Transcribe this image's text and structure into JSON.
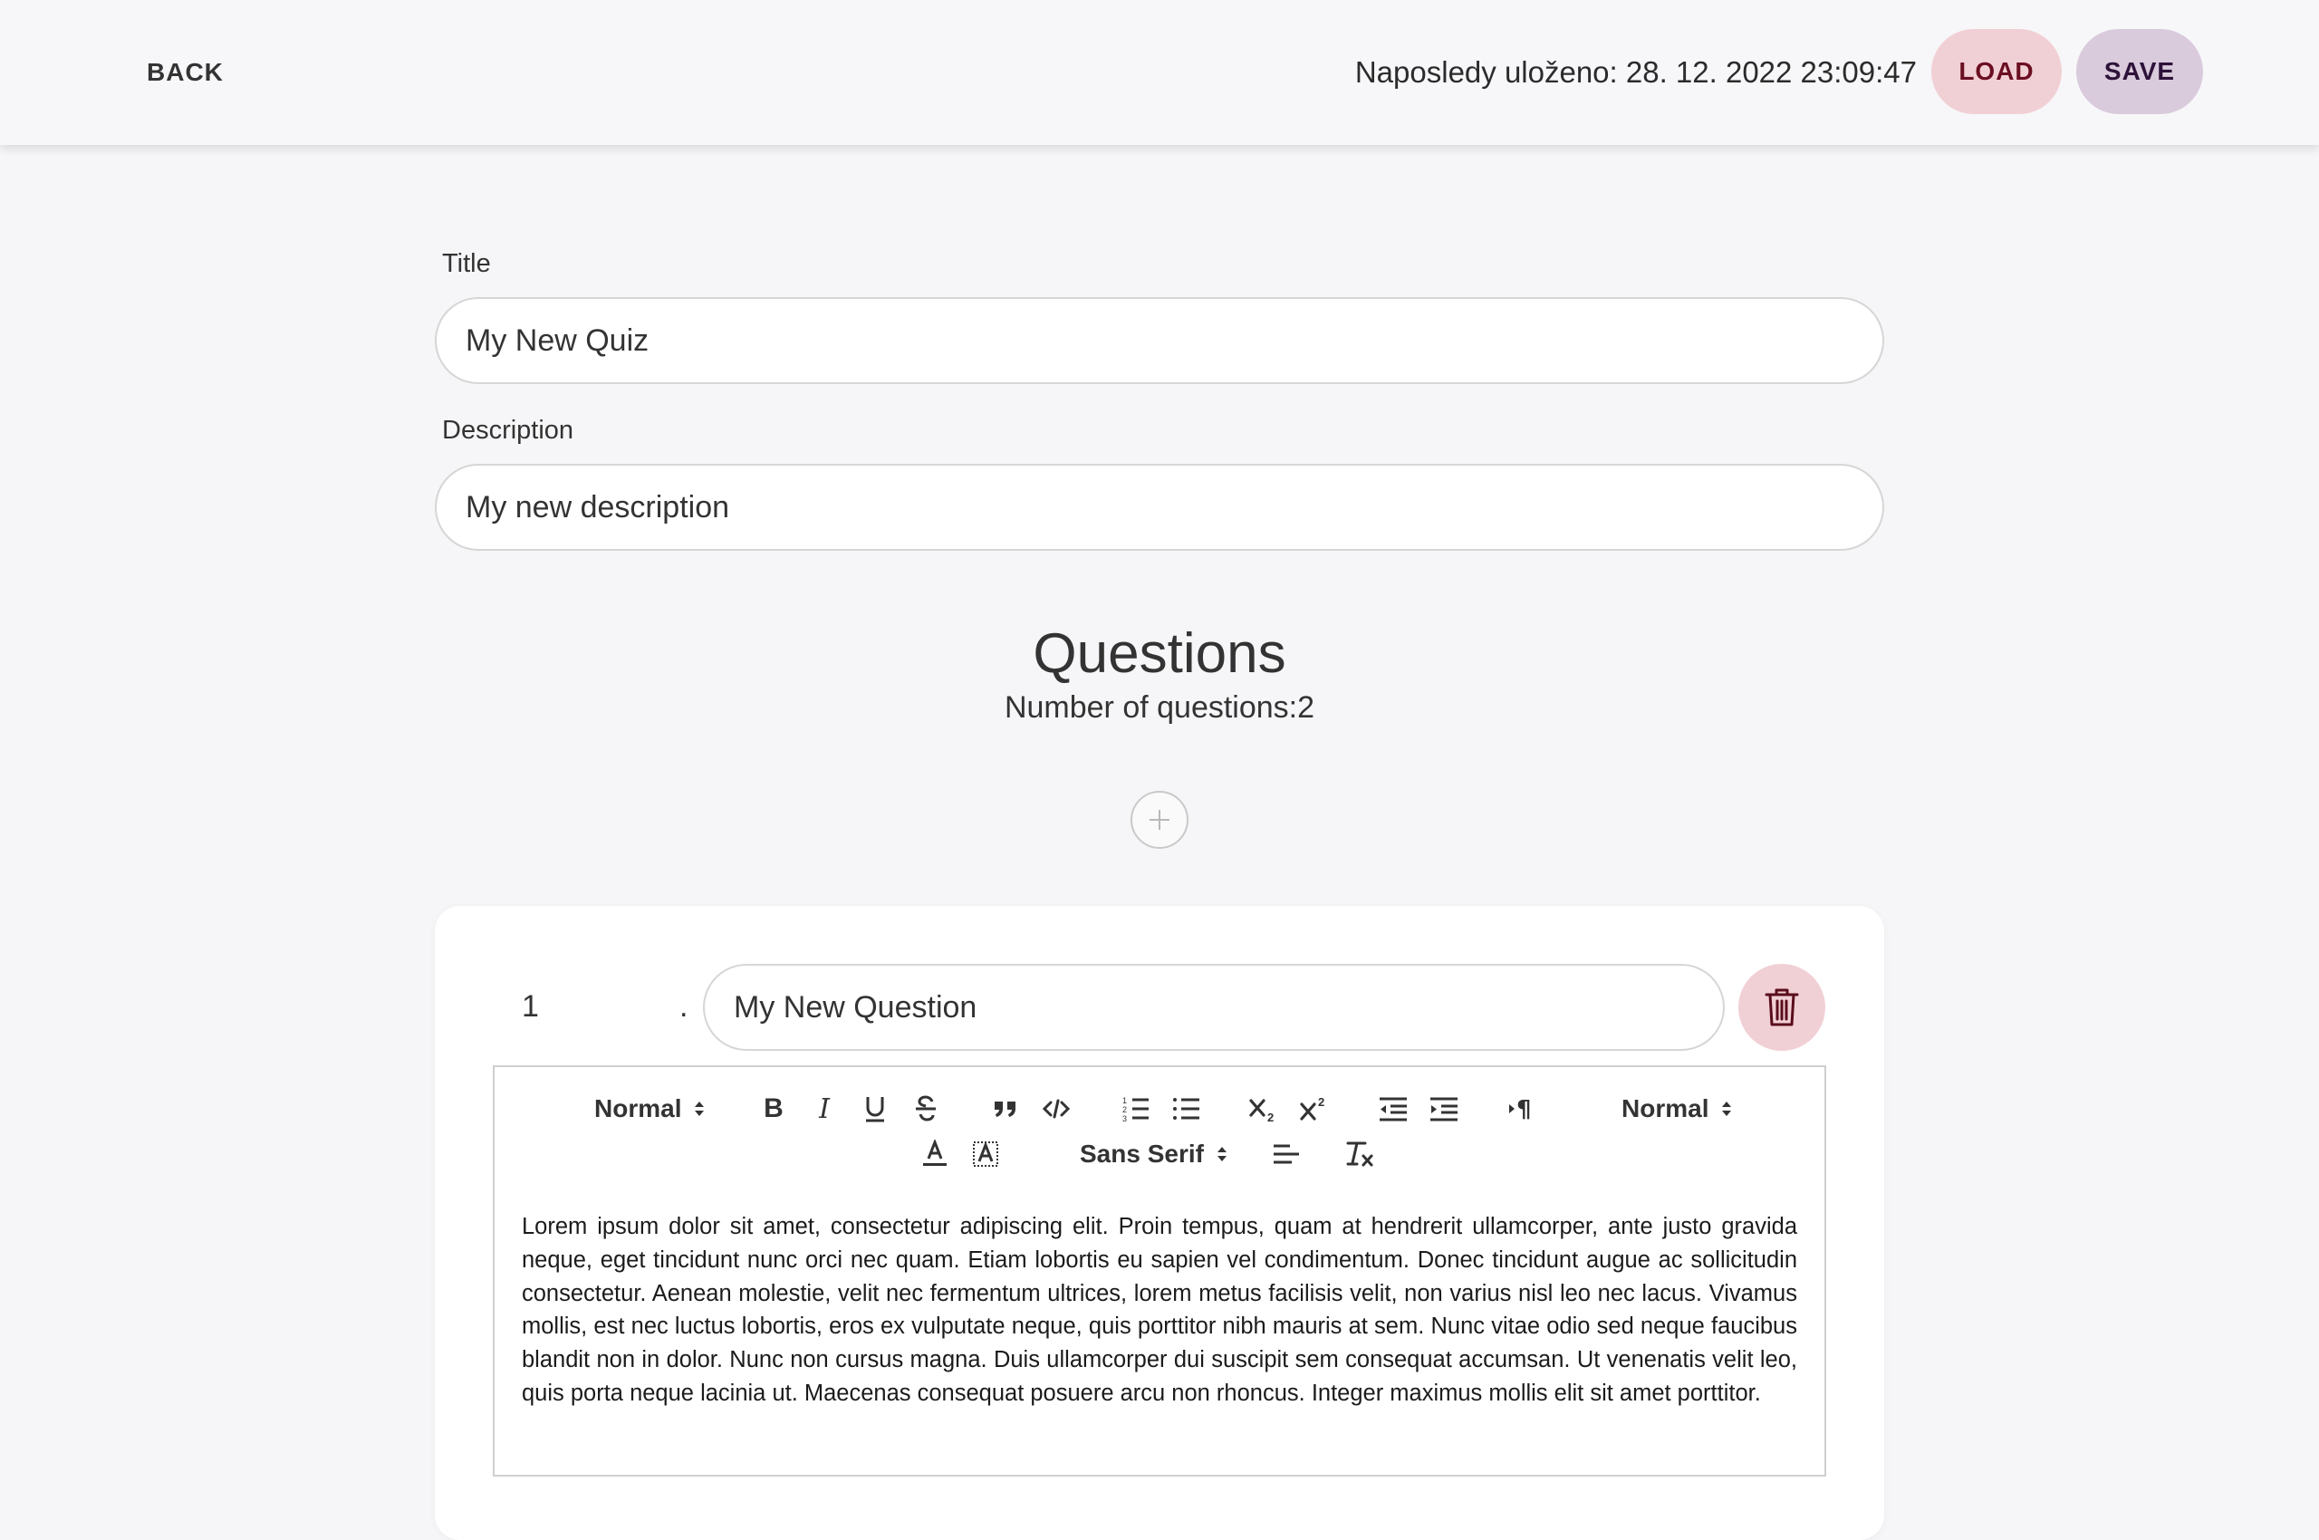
{
  "header": {
    "back_label": "BACK",
    "last_saved": "Naposledy uloženo: 28. 12. 2022 23:09:47",
    "load_label": "LOAD",
    "save_label": "SAVE"
  },
  "form": {
    "title_label": "Title",
    "title_value": "My New Quiz",
    "description_label": "Description",
    "description_value": "My new description"
  },
  "questions": {
    "heading": "Questions",
    "count_text": "Number of questions:2",
    "add_icon": "plus-icon"
  },
  "question_1": {
    "number": "1",
    "dot": ".",
    "title_value": "My New Question",
    "delete_icon": "trash-icon",
    "toolbar": {
      "header_select": "Normal",
      "size_select": "Normal",
      "font_select": "Sans Serif"
    },
    "body": "Lorem ipsum dolor sit amet, consectetur adipiscing elit. Proin tempus, quam at hendrerit ullamcorper, ante justo gravida neque, eget tincidunt nunc orci nec quam. Etiam lobortis eu sapien vel condimentum. Donec tincidunt augue ac sollicitudin consectetur. Aenean molestie, velit nec fermentum ultrices, lorem metus facilisis velit, non varius nisl leo nec lacus. Vivamus mollis, est nec luctus lobortis, eros ex vulputate neque, quis porttitor nibh mauris at sem. Nunc vitae odio sed neque faucibus blandit non in dolor. Nunc non cursus magna. Duis ullamcorper dui suscipit sem consequat accumsan. Ut venenatis velit leo, quis porta neque lacinia ut. Maecenas consequat posuere arcu non rhoncus. Integer maximus mollis elit sit amet porttitor."
  },
  "colors": {
    "load_bg": "#f1d0d5",
    "save_bg": "#d9cbdc",
    "delete_bg": "#f1d0d5",
    "page_bg": "#f6f6f8"
  }
}
